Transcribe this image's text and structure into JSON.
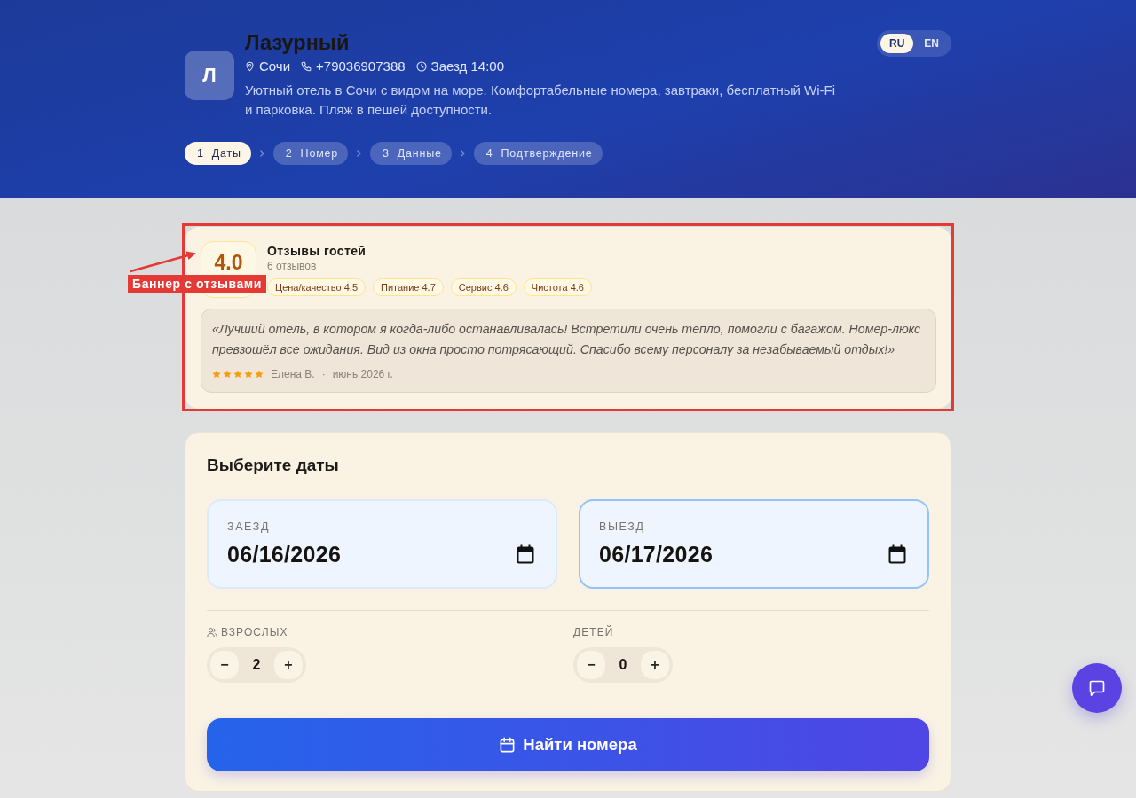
{
  "hotel": {
    "avatar_letter": "Л",
    "name": "Лазурный",
    "city": "Сочи",
    "phone": "+79036907388",
    "checkin_time": "Заезд 14:00",
    "description": "Уютный отель в Сочи с видом на море. Комфортабельные номера, завтраки, бесплатный Wi-Fi и парковка. Пляж в пешей доступности."
  },
  "languages": [
    {
      "label": "RU",
      "selected": true
    },
    {
      "label": "EN",
      "selected": false
    }
  ],
  "steps": [
    {
      "number": "1",
      "label": "Даты",
      "selected": true
    },
    {
      "number": "2",
      "label": "Номер",
      "selected": false
    },
    {
      "number": "3",
      "label": "Данные",
      "selected": false
    },
    {
      "number": "4",
      "label": "Подтверждение",
      "selected": false
    }
  ],
  "reviews_banner": {
    "rating": "4.0",
    "title": "Отзывы гостей",
    "count": "6 отзывов",
    "categories": [
      "Цена/качество 4.5",
      "Питание 4.7",
      "Сервис 4.6",
      "Чистота 4.6"
    ],
    "review": {
      "text": "«Лучший отель, в котором я когда-либо останавливалась! Встретили очень тепло, помогли с багажом. Номер-люкс превзошёл все ожидания. Вид из окна просто потрясающий. Спасибо всему персоналу за незабываемый отдых!»",
      "stars": 5,
      "author": "Елена В.",
      "separator": "·",
      "date": "июнь 2026 г."
    }
  },
  "annotation": {
    "label": "Баннер с отзывами"
  },
  "dates_form": {
    "title": "Выберите даты",
    "fields": [
      {
        "label": "ЗАЕЗД",
        "value": "06/16/2026",
        "focused": false
      },
      {
        "label": "ВЫЕЗД",
        "value": "06/17/2026",
        "focused": true
      }
    ],
    "guests": [
      {
        "kind": "adults",
        "label": "ВЗРОСЛЫХ",
        "value": "2",
        "decrement": "−",
        "increment": "+"
      },
      {
        "kind": "children",
        "label": "ДЕТЕЙ",
        "value": "0",
        "decrement": "−",
        "increment": "+"
      }
    ],
    "submit": "Найти номера"
  }
}
